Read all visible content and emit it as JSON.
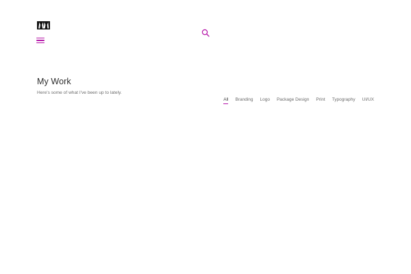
{
  "brand": {
    "logo_icon": "brand-monogram-icon",
    "accent_color": "#b514a8"
  },
  "header": {
    "menu_icon": "hamburger-menu-icon",
    "search_icon": "search-icon"
  },
  "section": {
    "title": "My Work",
    "subtitle": "Here's some of what I've been up to lately."
  },
  "filters": {
    "active": "All",
    "items": [
      "All",
      "Branding",
      "Logo",
      "Package Design",
      "Print",
      "Typography",
      "UI/UX"
    ]
  }
}
